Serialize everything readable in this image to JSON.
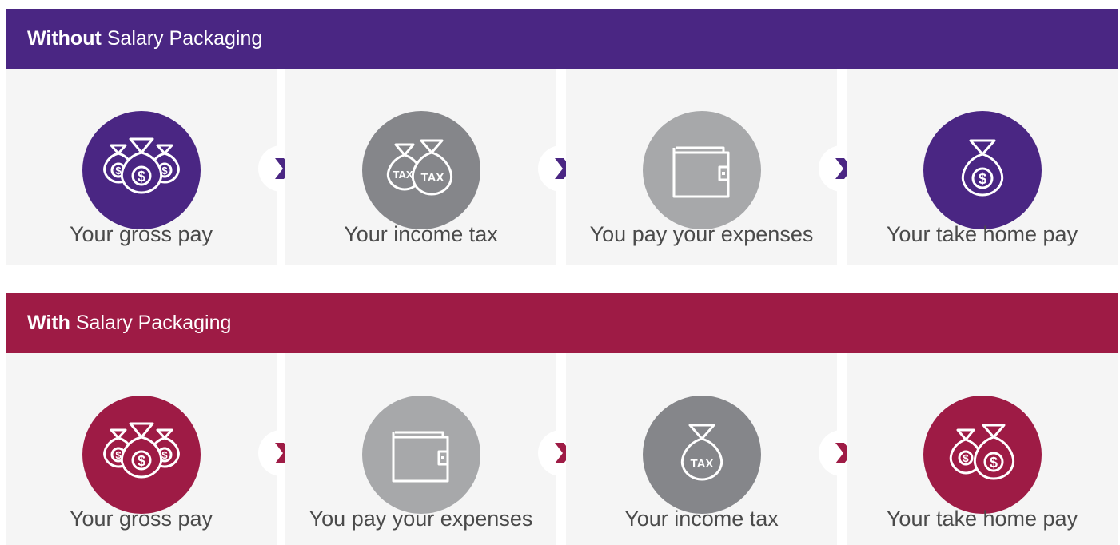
{
  "colors": {
    "purple": "#4a2683",
    "crimson": "#9e1b45",
    "dark_gray": "#85868a",
    "light_gray": "#a7a8aa",
    "panel_bg": "#f5f5f5",
    "label_text": "#4a4a4a"
  },
  "without": {
    "title_bold": "Without",
    "title_rest": " Salary Packaging",
    "steps": [
      {
        "label": "Your gross pay",
        "icon": "three-money-bags-icon"
      },
      {
        "label": "Your income tax",
        "icon": "two-tax-bags-icon",
        "tax_text": "TAX"
      },
      {
        "label": "You pay your expenses",
        "icon": "wallet-icon"
      },
      {
        "label": "Your take home pay",
        "icon": "money-bag-icon"
      }
    ]
  },
  "with": {
    "title_bold": "With",
    "title_rest": " Salary Packaging",
    "steps": [
      {
        "label": "Your gross pay",
        "icon": "three-money-bags-icon"
      },
      {
        "label": "You pay your expenses",
        "icon": "wallet-icon"
      },
      {
        "label": "Your income tax",
        "icon": "tax-bag-icon",
        "tax_text": "TAX"
      },
      {
        "label": "Your take home pay",
        "icon": "two-money-bags-icon"
      }
    ]
  }
}
